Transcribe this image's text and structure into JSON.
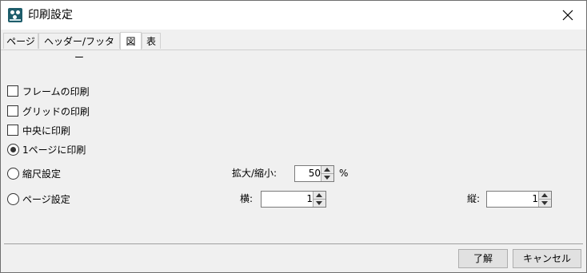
{
  "window": {
    "title": "印刷設定",
    "app_icon": "app-icon",
    "close_icon": "close-icon"
  },
  "tabs": [
    {
      "label": "ページ",
      "active": false
    },
    {
      "label": "ヘッダー/フッター",
      "active": false
    },
    {
      "label": "図",
      "active": true
    },
    {
      "label": "表",
      "active": false
    }
  ],
  "options": {
    "frame": {
      "label": "フレームの印刷",
      "checked": false
    },
    "grid": {
      "label": "グリッドの印刷",
      "checked": false
    },
    "center": {
      "label": "中央に印刷",
      "checked": false
    },
    "fit_page": {
      "label": "1ページに印刷",
      "selected": true
    },
    "scale": {
      "label": "縮尺設定",
      "selected": false
    },
    "page_setup": {
      "label": "ページ設定",
      "selected": false
    }
  },
  "scale_field": {
    "label": "拡大/縮小:",
    "value": "50",
    "unit": "%"
  },
  "horizontal_field": {
    "label": "横:",
    "value": "1"
  },
  "vertical_field": {
    "label": "縦:",
    "value": "1"
  },
  "buttons": {
    "ok": "了解",
    "cancel": "キャンセル"
  },
  "colors": {
    "background": "#f0f0f0",
    "titlebar": "#ffffff",
    "app_icon": "#1e5d6b"
  }
}
